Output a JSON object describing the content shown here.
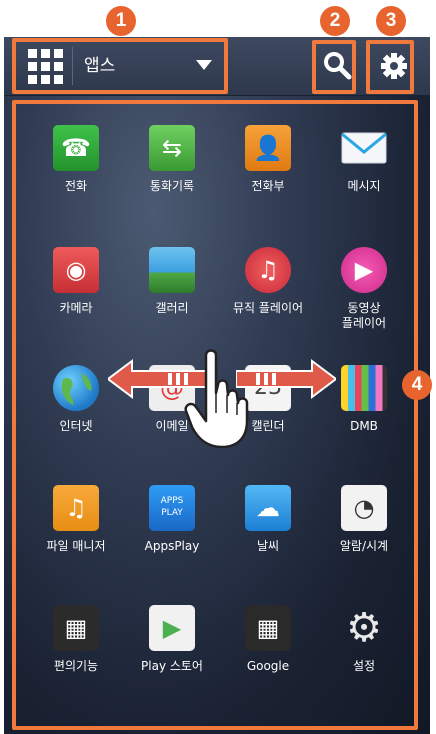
{
  "top_bar": {
    "app_selector_label": "앱스",
    "search_label": "",
    "settings_label": ""
  },
  "callouts": [
    "1",
    "2",
    "3",
    "4"
  ],
  "apps": [
    {
      "label": "전화",
      "icon": "phone-icon"
    },
    {
      "label": "통화기록",
      "icon": "call-log-icon"
    },
    {
      "label": "전화부",
      "icon": "contacts-icon"
    },
    {
      "label": "메시지",
      "icon": "message-icon"
    },
    {
      "label": "카메라",
      "icon": "camera-icon"
    },
    {
      "label": "갤러리",
      "icon": "gallery-icon"
    },
    {
      "label": "뮤직 플레이어",
      "icon": "music-icon"
    },
    {
      "label": "동영상\n플레이어",
      "icon": "video-icon"
    },
    {
      "label": "인터넷",
      "icon": "internet-icon"
    },
    {
      "label": "이메일",
      "icon": "email-icon"
    },
    {
      "label": "캘린더",
      "icon": "calendar-icon",
      "glyph_text": "23"
    },
    {
      "label": "DMB",
      "icon": "dmb-icon"
    },
    {
      "label": "파일 매니저",
      "icon": "file-manager-icon"
    },
    {
      "label": "AppsPlay",
      "icon": "appsplay-icon",
      "glyph_text": "APPS PLAY"
    },
    {
      "label": "날씨",
      "icon": "weather-icon"
    },
    {
      "label": "알람/시계",
      "icon": "clock-icon"
    },
    {
      "label": "편의기능",
      "icon": "tools-icon"
    },
    {
      "label": "Play 스토어",
      "icon": "play-store-icon"
    },
    {
      "label": "Google",
      "icon": "google-folder-icon"
    },
    {
      "label": "설정",
      "icon": "settings-app-icon"
    }
  ],
  "colors": {
    "callout": "#f07a3e",
    "badge": "#e8642f",
    "bar": "#3a445a"
  }
}
